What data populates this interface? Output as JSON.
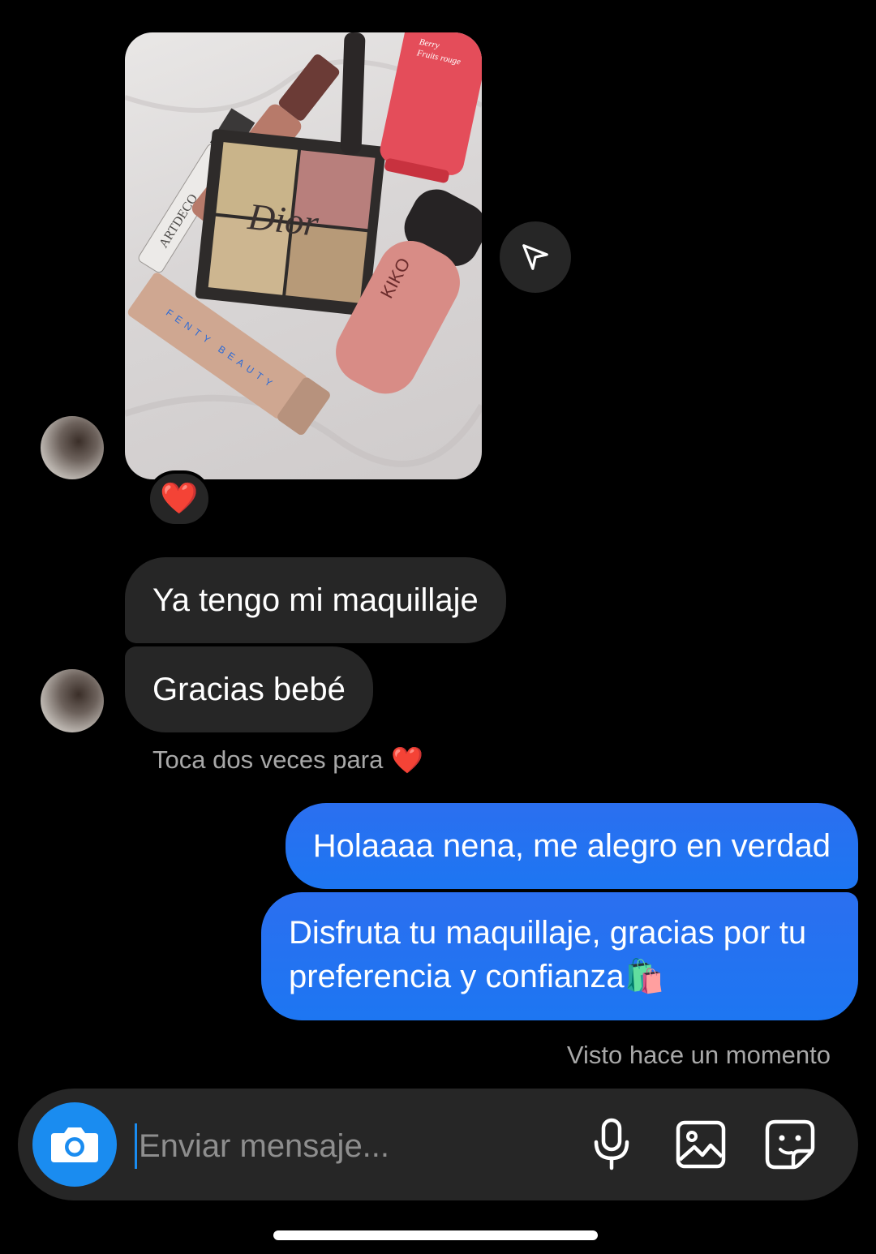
{
  "thread": {
    "photo": {
      "products": [
        "ARTDECO",
        "Dior",
        "FENTY BEAUTY",
        "KIKO",
        "Berry",
        "Fruits rouge"
      ],
      "reaction": "❤️"
    },
    "incoming": [
      {
        "text": "Ya tengo mi maquillaje"
      },
      {
        "text": "Gracias bebé"
      }
    ],
    "double_tap_hint": "Toca dos veces para",
    "double_tap_heart": "❤️",
    "outgoing": [
      {
        "text": "Holaaaa nena, me alegro en verdad"
      },
      {
        "text": "Disfruta tu maquillaje, gracias por tu preferencia y confianza🛍️"
      }
    ],
    "seen_status": "Visto hace un momento"
  },
  "composer": {
    "placeholder": "Enviar mensaje...",
    "icons": [
      "camera-icon",
      "microphone-icon",
      "gallery-icon",
      "sticker-icon"
    ]
  },
  "colors": {
    "background": "#000000",
    "incoming_bubble": "#262626",
    "outgoing_bubble": "#1d76f2",
    "accent": "#1a8cf0",
    "muted_text": "#a8a8a8"
  }
}
